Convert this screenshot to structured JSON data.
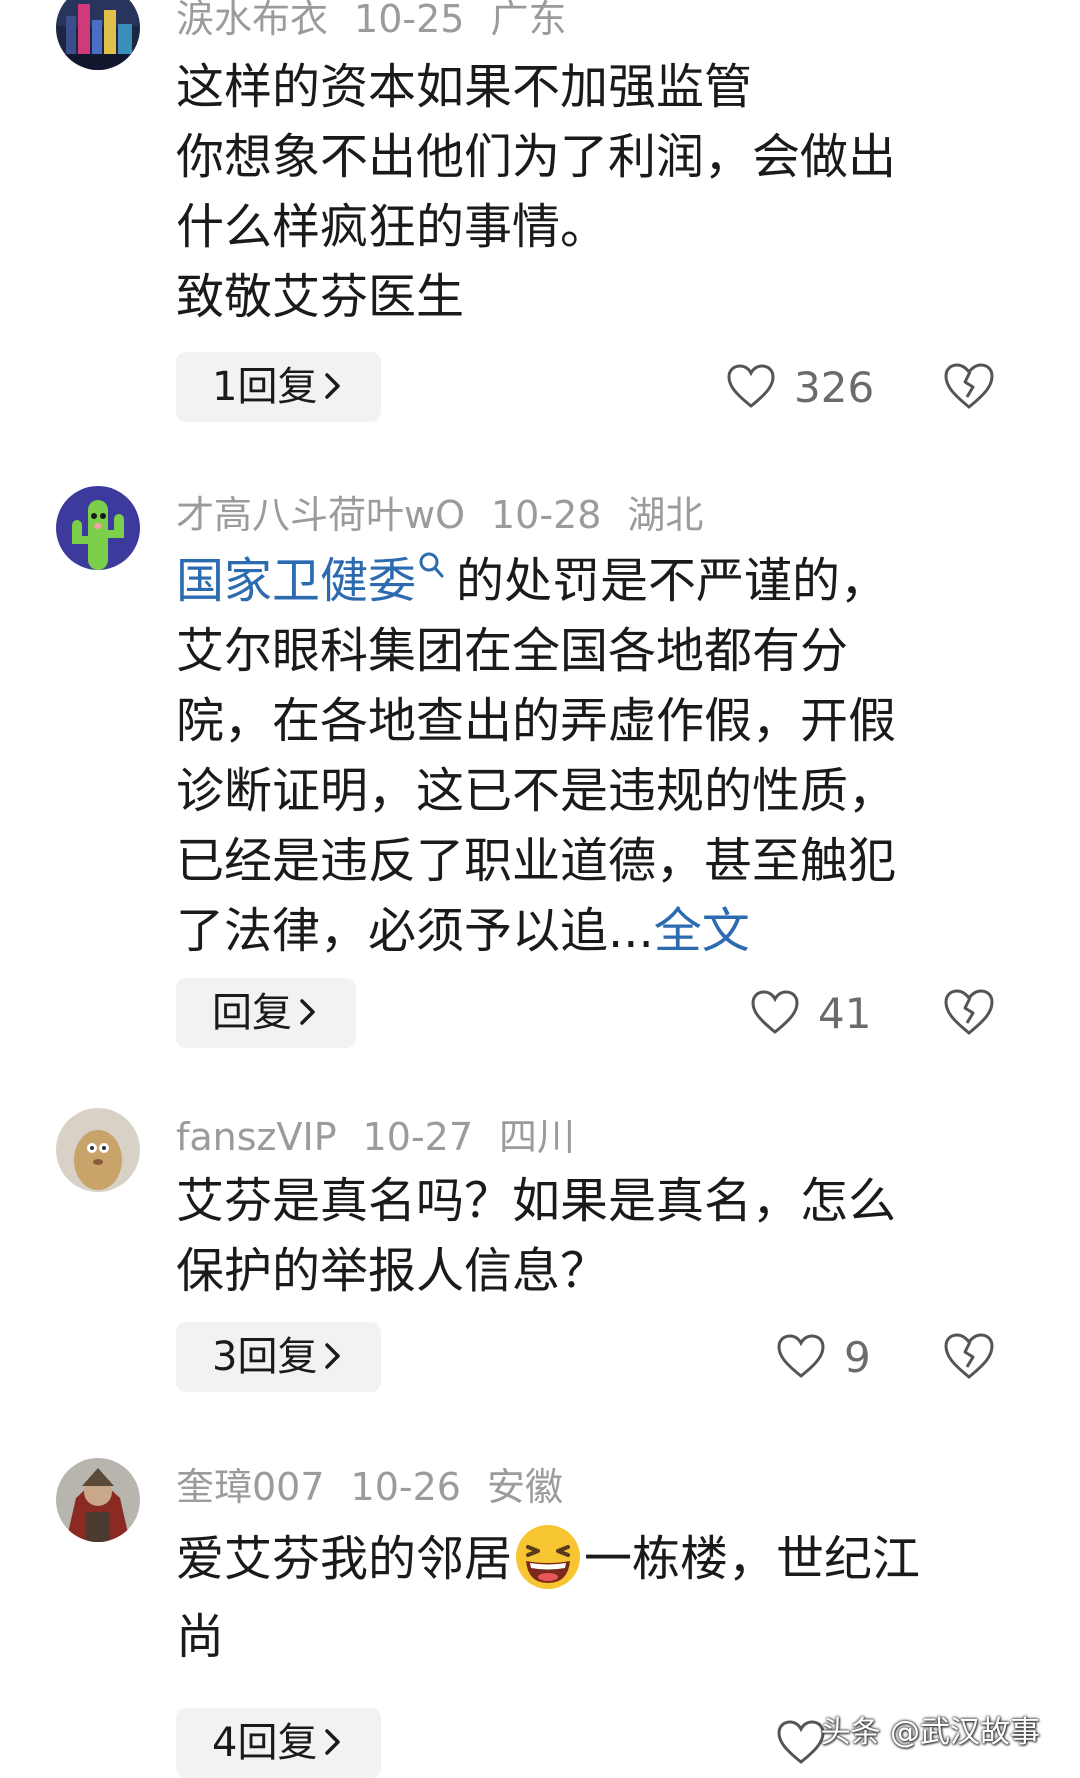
{
  "comments": [
    {
      "username": "涙水布衣",
      "date": "10-25",
      "region": "广东",
      "lines": [
        "这样的资本如果不加强监管",
        "你想象不出他们为了利润，会做出",
        "什么样疯狂的事情。",
        "致敬艾芬医生"
      ],
      "reply_label": "1回复",
      "like_count": "326",
      "avatar": "city-night-avatar"
    },
    {
      "username": "才高八斗荷叶wO",
      "date": "10-28",
      "region": "湖北",
      "link_text": "国家卫健委",
      "first_line_rest": "的处罚是不严谨的，",
      "lines": [
        "艾尔眼科集团在全国各地都有分",
        "院，在各地查出的弄虚作假，开假",
        "诊断证明，这已不是违规的性质，",
        "已经是违反了职业道德，甚至触犯"
      ],
      "last_line": "了法律，必须予以追...",
      "expand_label": "全文",
      "reply_label": "回复",
      "like_count": "41",
      "avatar": "cactus-avatar"
    },
    {
      "username": "fanszVIP",
      "date": "10-27",
      "region": "四川",
      "lines": [
        "艾芬是真名吗？如果是真名，怎么",
        "保护的举报人信息？"
      ],
      "reply_label": "3回复",
      "like_count": "9",
      "avatar": "cartoon-avatar"
    },
    {
      "username": "奎璋007",
      "date": "10-26",
      "region": "安徽",
      "line1_before": "爱艾芬我的邻居",
      "line1_after": "一栋楼，世纪江",
      "line2": "尚",
      "emoji": "laughing-emoji",
      "reply_label": "4回复",
      "avatar": "warrior-avatar"
    }
  ],
  "watermark": "头条 @武汉故事",
  "colors": {
    "meta": "#9b9b9b",
    "text": "#1a1a1a",
    "link": "#2d6bb1",
    "button_bg": "#f2f2f2"
  }
}
